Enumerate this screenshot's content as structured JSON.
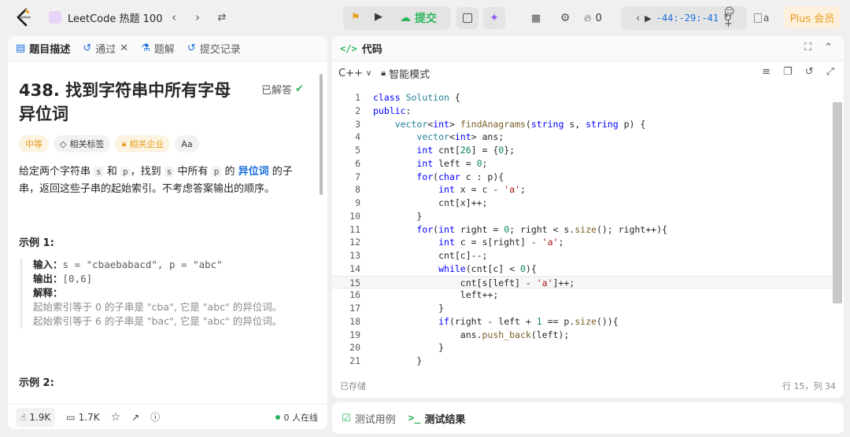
{
  "topbar": {
    "problem_list": "LeetCode 热题 100",
    "submit": "提交",
    "timer": "-44:-29:-41",
    "fire_count": "0",
    "avatar_alt": "a",
    "plus": "Plus 会员"
  },
  "left": {
    "tabs": [
      "题目描述",
      "通过",
      "题解",
      "提交记录"
    ],
    "title": "438. 找到字符串中所有字母异位词",
    "solved": "已解答",
    "tags": [
      "中等",
      "相关标签",
      "相关企业",
      "Aa"
    ],
    "desc": {
      "p1": "给定两个字符串 ",
      "s": "s",
      "p2": " 和 ",
      "p": "p",
      "p3": "，找到 ",
      "s2": "s",
      "p4": " 中所有 ",
      "p5": "p",
      "p6": " 的 ",
      "kw": "异位词",
      "p7": " 的子串，返回这些子串的起始索引。不考虑答案输出的顺序。"
    },
    "example1_head": "示例 1:",
    "example1": {
      "input_label": "输入：",
      "input": "s = \"cbaebabacd\", p = \"abc\"",
      "output_label": "输出：",
      "output": "[0,6]",
      "explain_label": "解释：",
      "explain1": "起始索引等于 0 的子串是 \"cba\", 它是 \"abc\" 的异位词。",
      "explain2": "起始索引等于 6 的子串是 \"bac\", 它是 \"abc\" 的异位词。"
    },
    "example2_head": "示例 2:",
    "footer": {
      "likes": "1.9K",
      "comments": "1.7K",
      "online": "0 人在线"
    }
  },
  "right": {
    "header": "代码",
    "lang": "C++",
    "mode": "智能模式",
    "code_lines": [
      "class Solution {",
      "public:",
      "    vector<int> findAnagrams(string s, string p) {",
      "        vector<int> ans;",
      "        int cnt[26] = {0};",
      "        int left = 0;",
      "        for(char c : p){",
      "            int x = c - 'a';",
      "            cnt[x]++;",
      "        }",
      "        for(int right = 0; right < s.size(); right++){",
      "            int c = s[right] - 'a';",
      "            cnt[c]--;",
      "            while(cnt[c] < 0){",
      "                cnt[s[left] - 'a']++;",
      "                left++;",
      "            }",
      "            if(right - left + 1 == p.size()){",
      "                ans.push_back(left);",
      "            }",
      "        }"
    ],
    "saved": "已存储",
    "position": "行 15，列 34"
  },
  "bottom": {
    "tabs": [
      "测试用例",
      "测试结果"
    ]
  }
}
